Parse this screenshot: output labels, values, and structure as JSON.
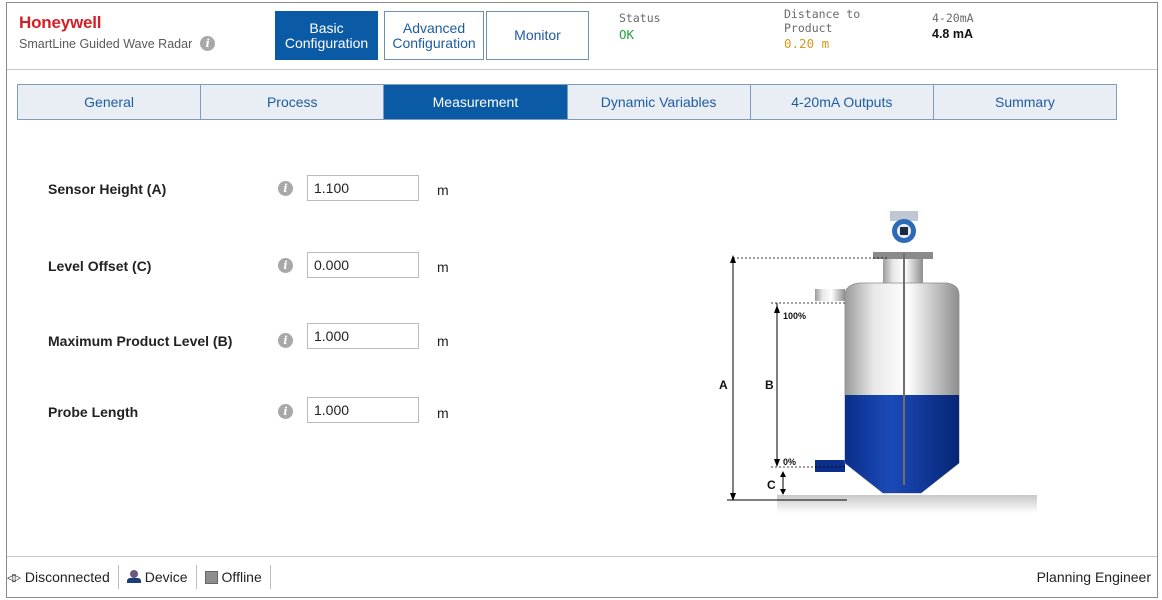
{
  "header": {
    "brand": "Honeywell",
    "product": "SmartLine Guided Wave Radar",
    "tabs": [
      {
        "label": "Basic Configuration",
        "line1": "Basic",
        "line2": "Configuration"
      },
      {
        "label": "Advanced Configuration",
        "line1": "Advanced",
        "line2": "Configuration"
      },
      {
        "label": "Monitor"
      }
    ],
    "status": {
      "label": "Status",
      "value": "OK"
    },
    "distance": {
      "label_line1": "Distance to",
      "label_line2": "Product",
      "value": "0.20 m"
    },
    "current": {
      "label": "4-20mA",
      "value": "4.8 mA"
    },
    "colors": {
      "brand": "#d31f26",
      "accent": "#0b5aa6",
      "ok": "#23a33a",
      "warn": "#d89a1b"
    }
  },
  "subtabs": [
    "General",
    "Process",
    "Measurement",
    "Dynamic Variables",
    "4-20mA Outputs",
    "Summary"
  ],
  "form": {
    "fields": [
      {
        "label": "Sensor Height  (A)",
        "value": "1.100",
        "unit": "m"
      },
      {
        "label": "Level Offset  (C)",
        "value": "0.000",
        "unit": "m"
      },
      {
        "label": "Maximum Product Level (B)",
        "value": "1.000",
        "unit": "m"
      },
      {
        "label": "Probe Length",
        "value": "1.000",
        "unit": "m"
      }
    ]
  },
  "diagram": {
    "labels": {
      "a": "A",
      "b": "B",
      "c": "C",
      "top": "100%",
      "bottom": "0%"
    }
  },
  "statusbar": {
    "connection": "Disconnected",
    "device": "Device",
    "mode": "Offline",
    "role": "Planning Engineer"
  }
}
